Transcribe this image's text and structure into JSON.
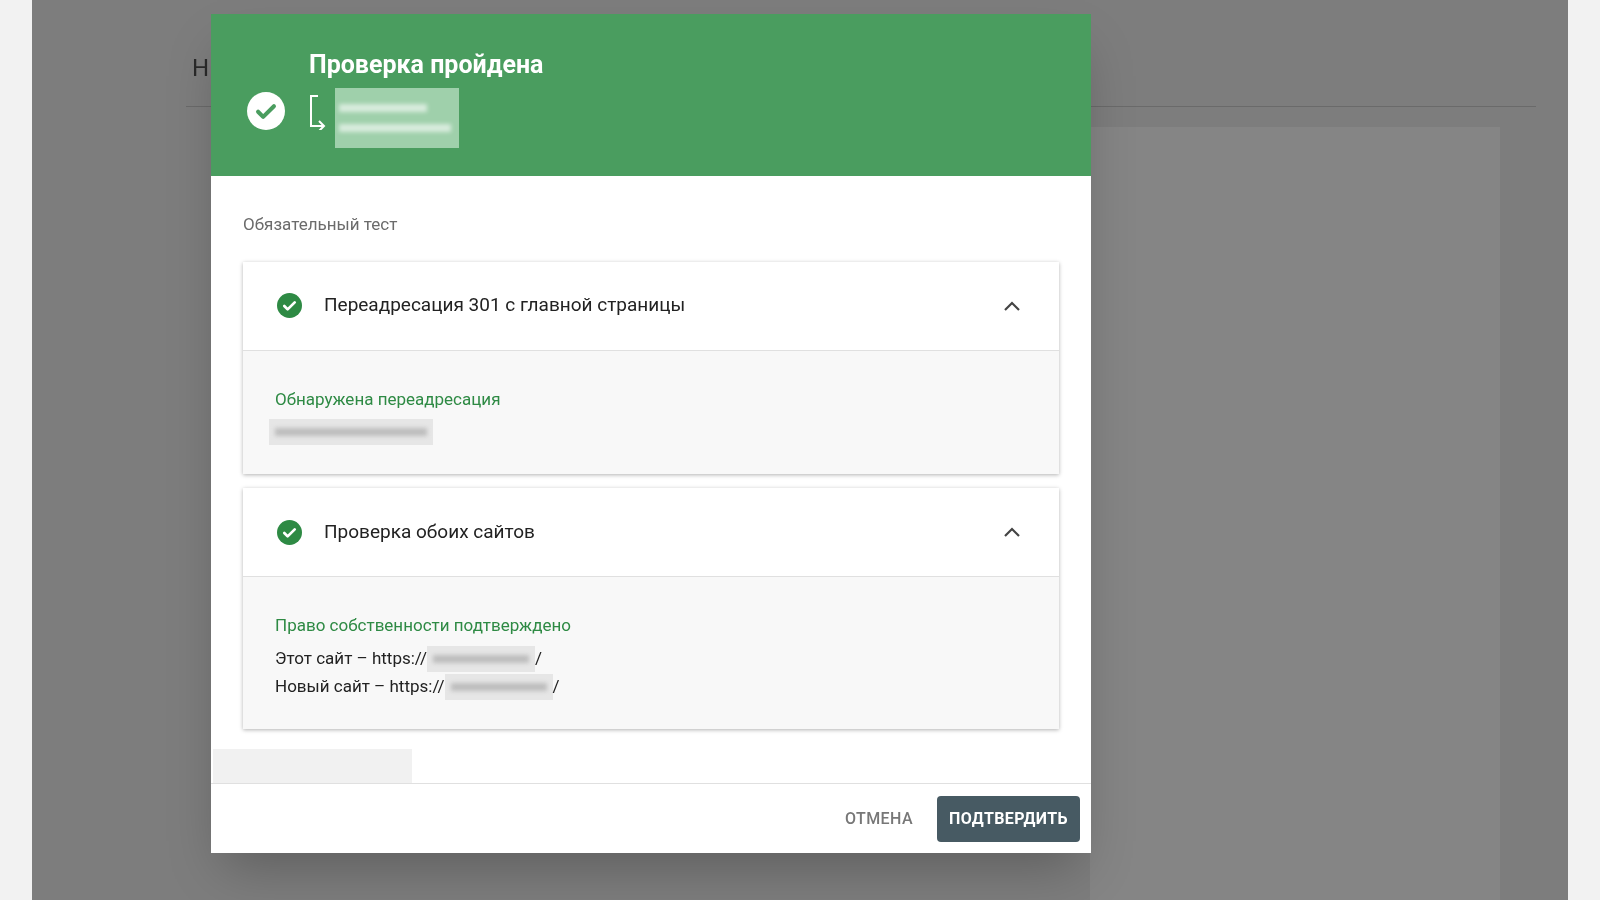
{
  "background": {
    "heading": "Н"
  },
  "dialog": {
    "title": "Проверка пройдена",
    "section_label": "Обязательный тест",
    "checks": [
      {
        "title": "Переадресация 301 с главной страницы",
        "passed": true,
        "expanded": true,
        "detail_title": "Обнаружена переадресация",
        "lines": [
          {
            "kind": "url"
          }
        ]
      },
      {
        "title": "Проверка обоих сайтов",
        "passed": true,
        "expanded": true,
        "detail_title": "Право собственности подтверждено",
        "lines": [
          {
            "kind": "text",
            "prefix": "Этот сайт – https://",
            "suffix": "/"
          },
          {
            "kind": "text",
            "prefix": "Новый сайт – https://",
            "suffix": "/"
          }
        ]
      }
    ],
    "buttons": [
      {
        "label": "ОТМЕНА",
        "kind": "text"
      },
      {
        "label": "ПОДТВЕРДИТЬ",
        "kind": "primary"
      }
    ]
  }
}
